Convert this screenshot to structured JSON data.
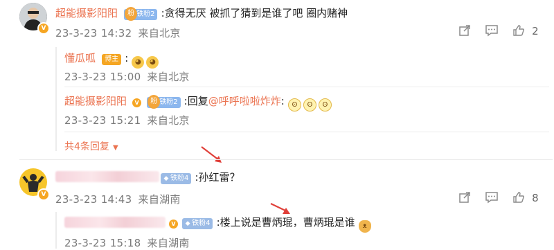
{
  "comments": [
    {
      "username": "超能摄影阳阳",
      "fan_badge": "铁粉2",
      "text": ":贪得无厌 被抓了猜到是谁了吧 圈内赌神",
      "date": "23-3-23 14:32",
      "location": "来自北京",
      "likes": "2",
      "replies": [
        {
          "username": "懂瓜呱",
          "host_badge": "博主",
          "text": ":",
          "date": "23-3-23 15:00",
          "location": "来自北京"
        },
        {
          "username": "超能摄影阳阳",
          "fan_badge": "铁粉2",
          "text_prefix": ":回复",
          "mention": "@呼呼啦啦炸炸",
          "text_suffix": ":",
          "date": "23-3-23 15:21",
          "location": "来自北京"
        }
      ],
      "more_replies": "共4条回复"
    },
    {
      "fan_badge": "铁粉4",
      "text": ":孙红雷？",
      "date": "23-3-23 14:43",
      "location": "来自湖南",
      "likes": "8",
      "replies": [
        {
          "fan_badge": "铁粉4",
          "text": ":楼上说是曹炳琨，曹炳琨是谁",
          "date": "23-3-23 15:18",
          "location": "来自湖南"
        }
      ]
    }
  ],
  "icons": {
    "share": "share-icon",
    "comment": "comment-icon",
    "like": "thumbs-up-icon"
  },
  "colors": {
    "username": "#eb7350",
    "mention": "#eb7350",
    "meta": "#7a7a7a",
    "arrow": "#e0403a"
  }
}
